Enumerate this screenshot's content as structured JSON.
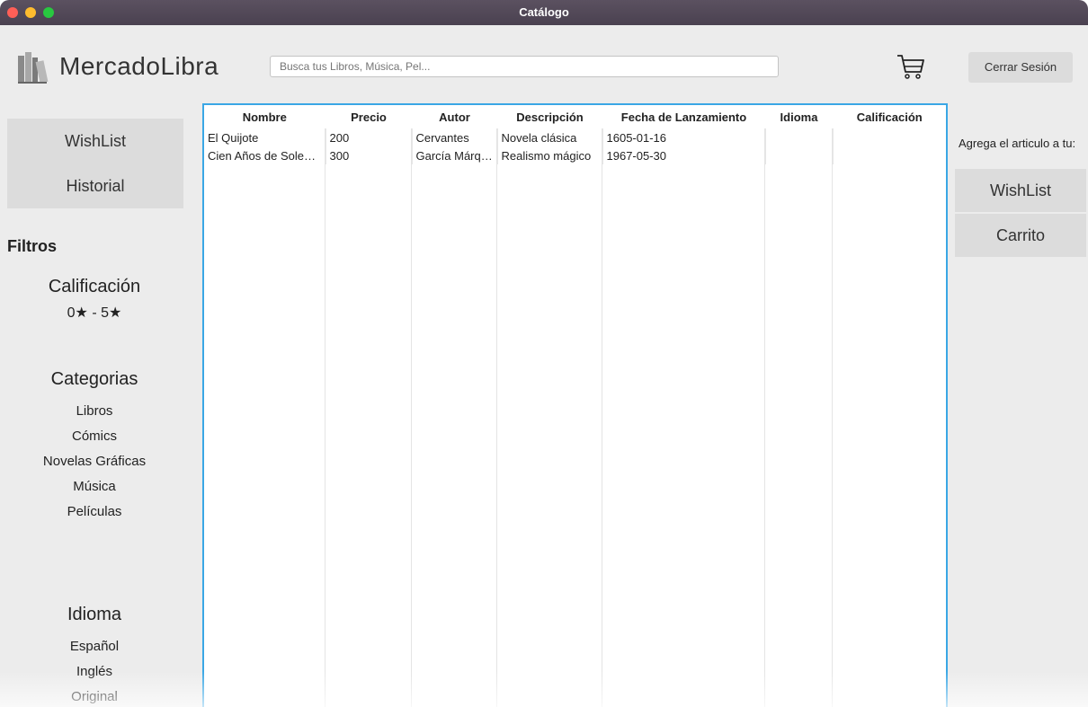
{
  "window": {
    "title": "Catálogo"
  },
  "header": {
    "brand": "MercadoLibra",
    "search_placeholder": "Busca tus Libros, Música, Pel...",
    "logout_label": "Cerrar Sesión"
  },
  "sidebar": {
    "wishlist_label": "WishList",
    "history_label": "Historial",
    "filters_title": "Filtros",
    "rating": {
      "title": "Calificación",
      "range": "0★ - 5★"
    },
    "categories": {
      "title": "Categorias",
      "items": [
        "Libros",
        "Cómics",
        "Novelas Gráficas",
        "Música",
        "Películas"
      ]
    },
    "language": {
      "title": "Idioma",
      "items": [
        "Español",
        "Inglés",
        "Original"
      ]
    }
  },
  "table": {
    "columns": [
      "Nombre",
      "Precio",
      "Autor",
      "Descripción",
      "Fecha de Lanzamiento",
      "Idioma",
      "Calificación"
    ],
    "rows": [
      [
        "El Quijote",
        "200",
        "Cervantes",
        "Novela clásica",
        "1605-01-16",
        "",
        ""
      ],
      [
        "Cien Años de Soledad",
        "300",
        "García Márquez",
        "Realismo mágico",
        "1967-05-30",
        "",
        ""
      ]
    ]
  },
  "right_panel": {
    "label": "Agrega el articulo a tu:",
    "wishlist_label": "WishList",
    "cart_label": "Carrito"
  },
  "icons": {
    "logo": "books-logo-icon",
    "cart": "shopping-cart-icon"
  },
  "colors": {
    "table_border": "#3aa7e5",
    "titlebar": "#4f4655"
  }
}
